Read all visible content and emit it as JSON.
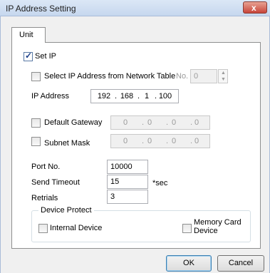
{
  "window": {
    "title": "IP Address Setting",
    "close_glyph": "x"
  },
  "tabs": [
    {
      "label": "Unit"
    }
  ],
  "set_ip": {
    "label": "Set IP",
    "checked": true
  },
  "select_from_table": {
    "label": "Select IP Address from Network Table",
    "checked": false,
    "no_label": "No.",
    "no_value": "0"
  },
  "ip_address": {
    "label": "IP Address",
    "octets": [
      "192",
      "168",
      "1",
      "100"
    ]
  },
  "default_gateway": {
    "label": "Default Gateway",
    "checked": false,
    "octets": [
      "0",
      "0",
      "0",
      "0"
    ]
  },
  "subnet_mask": {
    "label": "Subnet Mask",
    "checked": false,
    "octets": [
      "0",
      "0",
      "0",
      "0"
    ]
  },
  "port_no": {
    "label": "Port No.",
    "value": "10000"
  },
  "send_timeout": {
    "label": "Send Timeout",
    "value": "15",
    "unit": "*sec"
  },
  "retrials": {
    "label": "Retrials",
    "value": "3"
  },
  "device_protect": {
    "title": "Device Protect",
    "internal_device": {
      "label": "Internal Device",
      "checked": false
    },
    "memory_card": {
      "label_line1": "Memory Card",
      "label_line2": "Device",
      "checked": false
    }
  },
  "buttons": {
    "ok": "OK",
    "cancel": "Cancel"
  },
  "colors": {
    "title_bar": "#c6d7ee",
    "close_button": "#c8453a",
    "dialog_bg": "#f0f0f0",
    "default_button_border": "#3c7fb1"
  }
}
